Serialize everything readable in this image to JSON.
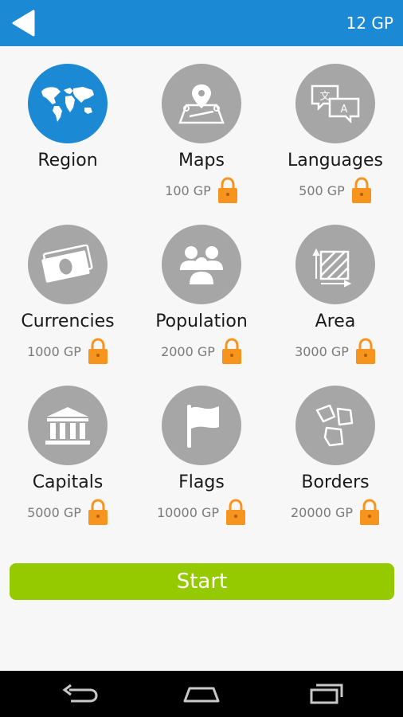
{
  "header": {
    "back_icon": "back-arrow-icon",
    "balance": "12 GP"
  },
  "categories": [
    {
      "label": "Region",
      "price": "",
      "icon": "world-map-icon",
      "locked": false,
      "selected": true
    },
    {
      "label": "Maps",
      "price": "100 GP",
      "icon": "map-pin-icon",
      "locked": true,
      "selected": false
    },
    {
      "label": "Languages",
      "price": "500 GP",
      "icon": "speech-bubbles-icon",
      "locked": true,
      "selected": false
    },
    {
      "label": "Currencies",
      "price": "1000 GP",
      "icon": "banknote-icon",
      "locked": true,
      "selected": false
    },
    {
      "label": "Population",
      "price": "2000 GP",
      "icon": "people-icon",
      "locked": true,
      "selected": false
    },
    {
      "label": "Area",
      "price": "3000 GP",
      "icon": "area-square-icon",
      "locked": true,
      "selected": false
    },
    {
      "label": "Capitals",
      "price": "5000 GP",
      "icon": "capitol-building-icon",
      "locked": true,
      "selected": false
    },
    {
      "label": "Flags",
      "price": "10000 GP",
      "icon": "flag-icon",
      "locked": true,
      "selected": false
    },
    {
      "label": "Borders",
      "price": "20000 GP",
      "icon": "borders-shapes-icon",
      "locked": true,
      "selected": false
    }
  ],
  "start_button": "Start",
  "navbar": {
    "back": "nav-back-icon",
    "home": "nav-home-icon",
    "recents": "nav-recents-icon"
  },
  "colors": {
    "primary_blue": "#1b89d3",
    "locked_gray": "#a6a6a6",
    "lock_orange": "#f7941d",
    "start_green": "#95c900"
  }
}
